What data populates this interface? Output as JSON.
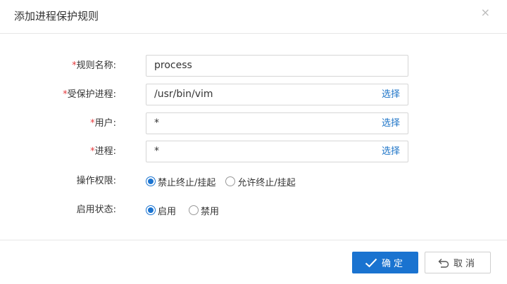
{
  "dialog": {
    "title": "添加进程保护规则",
    "close_glyph": "×"
  },
  "form": {
    "rule_name": {
      "label": "规则名称:",
      "value": "process"
    },
    "protected_process": {
      "label": "受保护进程:",
      "value": "/usr/bin/vim",
      "select_label": "选择"
    },
    "user": {
      "label": "用户:",
      "value": "*",
      "select_label": "选择"
    },
    "process": {
      "label": "进程:",
      "value": "*",
      "select_label": "选择"
    },
    "operation_permission": {
      "label": "操作权限:",
      "options": [
        "禁止终止/挂起",
        "允许终止/挂起"
      ],
      "selected": "禁止终止/挂起"
    },
    "enable_status": {
      "label": "启用状态:",
      "options": [
        "启用",
        "禁用"
      ],
      "selected": "启用"
    }
  },
  "footer": {
    "confirm_label": "确定",
    "cancel_label": "取消"
  },
  "colors": {
    "primary": "#1a73d0",
    "required": "#e4393c",
    "link": "#1c73c7"
  },
  "icons": {
    "confirm": "check-icon",
    "cancel": "undo-icon",
    "close": "close-icon"
  }
}
